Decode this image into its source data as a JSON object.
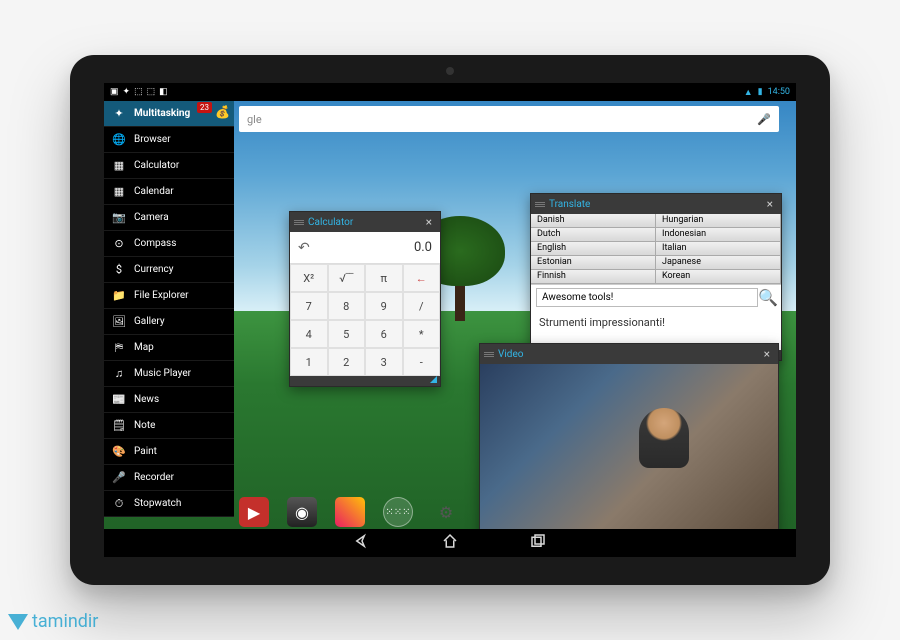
{
  "statusbar": {
    "time": "14:50"
  },
  "sidebar": {
    "items": [
      {
        "label": "Multitasking"
      },
      {
        "label": "Browser"
      },
      {
        "label": "Calculator"
      },
      {
        "label": "Calendar"
      },
      {
        "label": "Camera"
      },
      {
        "label": "Compass"
      },
      {
        "label": "Currency"
      },
      {
        "label": "File Explorer"
      },
      {
        "label": "Gallery"
      },
      {
        "label": "Map"
      },
      {
        "label": "Music Player"
      },
      {
        "label": "News"
      },
      {
        "label": "Note"
      },
      {
        "label": "Paint"
      },
      {
        "label": "Recorder"
      },
      {
        "label": "Stopwatch"
      }
    ],
    "badge": "23"
  },
  "search": {
    "hint": "gle"
  },
  "calculator": {
    "title": "Calculator",
    "display": "0.0",
    "keys": [
      "X²",
      "√‾‾",
      "π",
      "←",
      "7",
      "8",
      "9",
      "/",
      "4",
      "5",
      "6",
      "*",
      "1",
      "2",
      "3",
      "-"
    ]
  },
  "translate": {
    "title": "Translate",
    "left": [
      "Danish",
      "Dutch",
      "English",
      "Estonian",
      "Finnish"
    ],
    "right": [
      "Hungarian",
      "Indonesian",
      "Italian",
      "Japanese",
      "Korean"
    ],
    "input": "Awesome tools!",
    "output": "Strumenti impressionanti!"
  },
  "video": {
    "title": "Video"
  },
  "watermark": "tamindir"
}
